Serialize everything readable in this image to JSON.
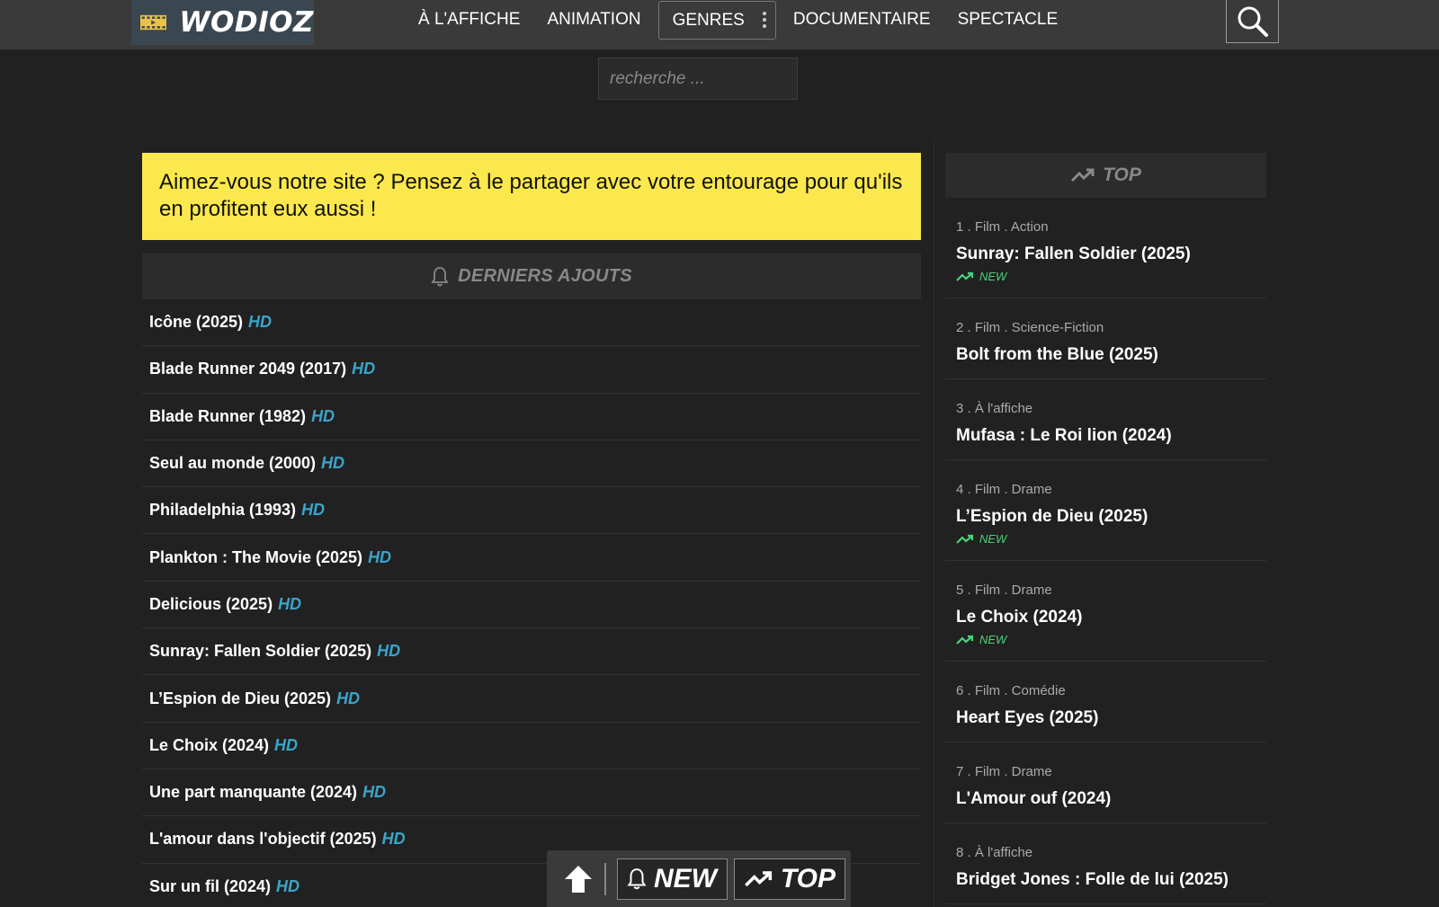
{
  "brand": {
    "name": "WODIOZ"
  },
  "nav": {
    "items": [
      "À L'AFFICHE",
      "ANIMATION",
      "GENRES",
      "DOCUMENTAIRE",
      "SPECTACLE"
    ]
  },
  "search": {
    "placeholder": "recherche ..."
  },
  "promo": {
    "text": "Aimez-vous notre site ? Pensez à le partager avec votre entourage pour qu'ils en profitent eux aussi !"
  },
  "latest": {
    "heading": "DERNIERS AJOUTS",
    "badge": "HD",
    "items": [
      "Icône (2025)",
      "Blade Runner 2049 (2017)",
      "Blade Runner (1982)",
      "Seul au monde (2000)",
      "Philadelphia (1993)",
      "Plankton : The Movie (2025)",
      "Delicious (2025)",
      "Sunray: Fallen Soldier (2025)",
      "L’Espion de Dieu (2025)",
      "Le Choix (2024)",
      "Une part manquante (2024)",
      "L'amour dans l'objectif (2025)",
      "Sur un fil (2024)"
    ]
  },
  "top": {
    "heading": "TOP",
    "new_label": "NEW",
    "items": [
      {
        "meta": "1 . Film . Action",
        "title": "Sunray: Fallen Soldier (2025)",
        "is_new": true
      },
      {
        "meta": "2 . Film . Science-Fiction",
        "title": "Bolt from the Blue (2025)",
        "is_new": false
      },
      {
        "meta": "3 . À l'affiche",
        "title": "Mufasa : Le Roi lion (2024)",
        "is_new": false
      },
      {
        "meta": "4 . Film . Drame",
        "title": "L’Espion de Dieu (2025)",
        "is_new": true
      },
      {
        "meta": "5 . Film . Drame",
        "title": "Le Choix (2024)",
        "is_new": true
      },
      {
        "meta": "6 . Film . Comédie",
        "title": "Heart Eyes (2025)",
        "is_new": false
      },
      {
        "meta": "7 . Film . Drame",
        "title": "L'Amour ouf (2024)",
        "is_new": false
      },
      {
        "meta": "8 . À l'affiche",
        "title": "Bridget Jones : Folle de lui (2025)",
        "is_new": false
      }
    ]
  },
  "floatbar": {
    "new_label": "NEW",
    "top_label": "TOP"
  },
  "colors": {
    "accent_yellow": "#fbe84e",
    "hd_blue": "#3aa5c9",
    "new_green": "#4bd17a"
  }
}
